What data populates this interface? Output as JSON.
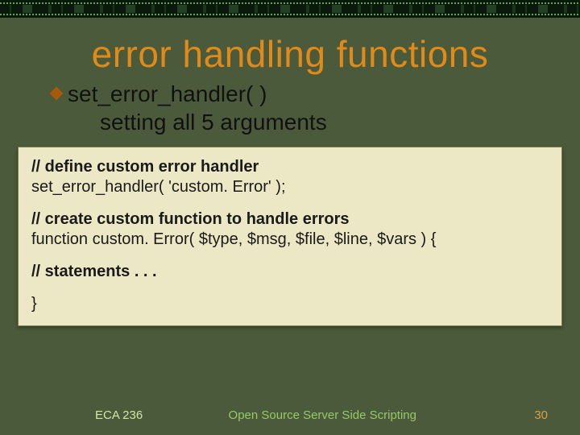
{
  "slide": {
    "title": "error handling functions",
    "bullet_main": "set_error_handler( )",
    "bullet_sub": "setting all 5 arguments"
  },
  "code": {
    "c1_comment": "//  define custom error handler",
    "c1_line": "set_error_handler( 'custom. Error' );",
    "c2_comment": "//  create custom function to handle errors",
    "c2_line": "function custom. Error( $type, $msg, $file, $line, $vars ) {",
    "c3_comment": "// statements . . .",
    "c4_line": "}"
  },
  "footer": {
    "course": "ECA 236",
    "subtitle": "Open Source Server Side Scripting",
    "page": "30"
  }
}
